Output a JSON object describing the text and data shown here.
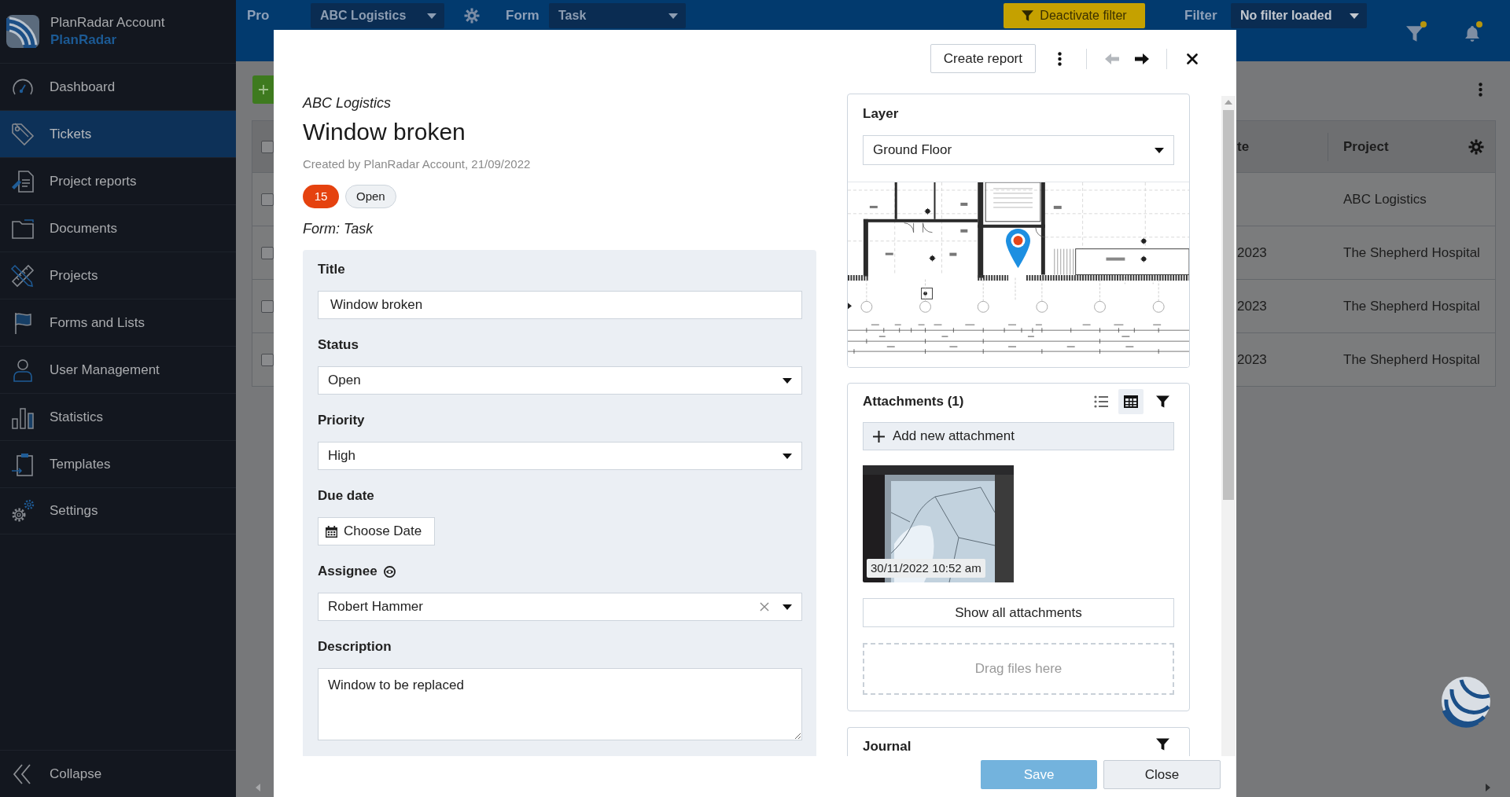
{
  "sidebar": {
    "account": "PlanRadar Account",
    "brand": "PlanRadar",
    "items": [
      {
        "label": "Dashboard",
        "selected": false
      },
      {
        "label": "Tickets",
        "selected": true
      },
      {
        "label": "Project reports",
        "selected": false
      },
      {
        "label": "Documents",
        "selected": false
      },
      {
        "label": "Projects",
        "selected": false
      },
      {
        "label": "Forms and Lists",
        "selected": false
      },
      {
        "label": "User Management",
        "selected": false
      },
      {
        "label": "Statistics",
        "selected": false
      },
      {
        "label": "Templates",
        "selected": false
      },
      {
        "label": "Settings",
        "selected": false
      }
    ],
    "collapse": "Collapse"
  },
  "header": {
    "project_label": "Pro",
    "project_value": "ABC Logistics",
    "form_label": "Form",
    "form_value": "Task",
    "deactivate_filter": "Deactivate filter",
    "filter_label": "Filter",
    "filter_value": "No filter loaded"
  },
  "table": {
    "all_checked": false,
    "columns": {
      "column_1": "te",
      "project": "Project"
    },
    "rows": [
      {
        "checked": false,
        "project": "ABC Logistics"
      },
      {
        "checked": false,
        "column_1": "2023",
        "project": "The Shepherd Hospital"
      },
      {
        "checked": false,
        "column_1": "2023",
        "project": "The Shepherd Hospital"
      },
      {
        "checked": false,
        "column_1": "2023",
        "project": "The Shepherd Hospital"
      }
    ]
  },
  "ticket": {
    "toolbar": {
      "create_report": "Create report",
      "previous_disabled": true,
      "next_disabled": false
    },
    "project": "ABC Logistics",
    "title": "Window broken",
    "created": "Created by PlanRadar Account, 21/09/2022",
    "number": "15",
    "status": "Open",
    "form": "Form: Task",
    "fields": [
      {
        "kind": "text",
        "label": "Title",
        "value": "Window broken"
      },
      {
        "kind": "select",
        "label": "Status",
        "value": "Open"
      },
      {
        "kind": "select",
        "label": "Priority",
        "value": "High"
      },
      {
        "kind": "date",
        "label": "Due date",
        "value": "Choose Date"
      },
      {
        "kind": "user",
        "label": "Assignee",
        "value": "Robert Hammer"
      },
      {
        "kind": "textarea",
        "label": "Description",
        "value": "Window to be replaced"
      }
    ],
    "layer": {
      "label": "Layer",
      "value": "Ground Floor"
    },
    "attachments": {
      "title": "Attachments (1)",
      "views": [
        {
          "selected": false
        },
        {
          "selected": true
        }
      ],
      "add": "Add new attachment",
      "items": [
        {
          "timestamp": "30/11/2022 10:52 am"
        }
      ],
      "show_all": "Show all attachments",
      "drop_zone": "Drag files here"
    },
    "journal": {
      "title": "Journal"
    },
    "footer": {
      "save": {
        "label": "Save",
        "disabled": true
      },
      "close": "Close"
    }
  }
}
